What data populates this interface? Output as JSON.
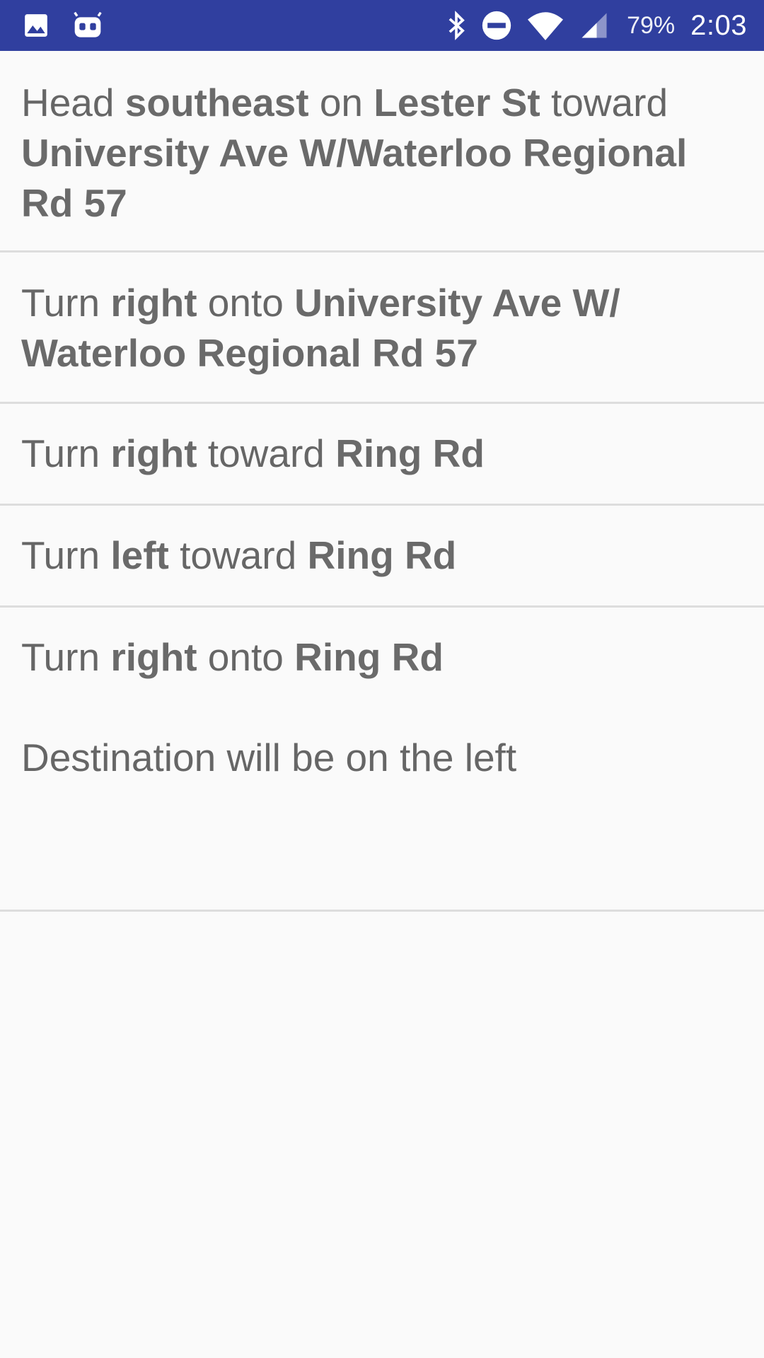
{
  "status_bar": {
    "battery": "79%",
    "time": "2:03",
    "icons": [
      "image-icon",
      "robot-icon",
      "bluetooth-icon",
      "do-not-disturb-icon",
      "wifi-icon",
      "cell-signal-icon"
    ],
    "color": "#303f9f"
  },
  "steps": [
    {
      "parts": [
        "Head ",
        "southeast",
        " on ",
        "Lester St",
        " toward ",
        "University Ave W/Waterloo Regional Rd 57"
      ]
    },
    {
      "parts": [
        "Turn ",
        "right",
        " onto ",
        "University Ave W/ Waterloo Regional Rd 57"
      ]
    },
    {
      "parts": [
        "Turn ",
        "right",
        " toward ",
        "Ring Rd"
      ]
    },
    {
      "parts": [
        "Turn ",
        "left",
        " toward ",
        "Ring Rd"
      ]
    },
    {
      "parts": [
        "Turn ",
        "right",
        " onto ",
        "Ring Rd"
      ],
      "note": "Destination will be on the left"
    }
  ]
}
